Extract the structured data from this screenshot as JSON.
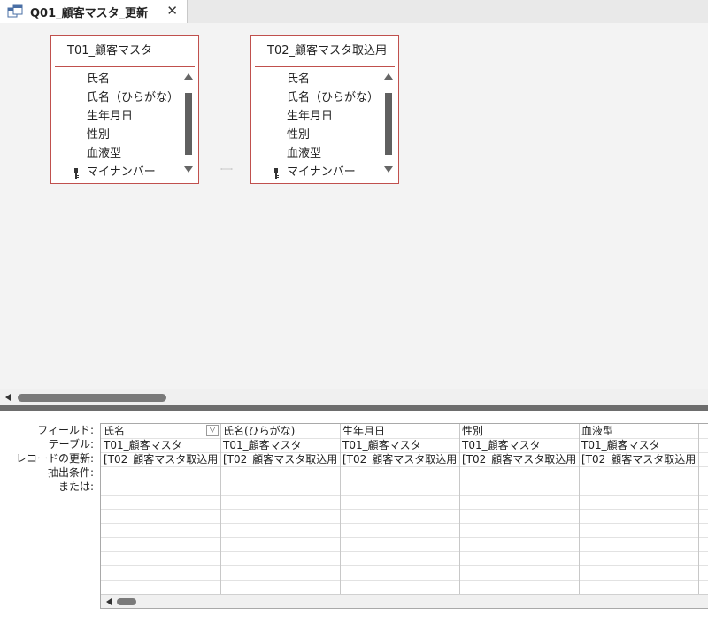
{
  "tab": {
    "title": "Q01_顧客マスタ_更新",
    "close_glyph": "✕",
    "icon": "query-icon"
  },
  "tables": [
    {
      "title": "T01_顧客マスタ",
      "fields": [
        {
          "name": "氏名",
          "key": false
        },
        {
          "name": "氏名（ひらがな）",
          "key": false
        },
        {
          "name": "生年月日",
          "key": false
        },
        {
          "name": "性別",
          "key": false
        },
        {
          "name": "血液型",
          "key": false
        },
        {
          "name": "マイナンバー",
          "key": true
        }
      ]
    },
    {
      "title": "T02_顧客マスタ取込用",
      "fields": [
        {
          "name": "氏名",
          "key": false
        },
        {
          "name": "氏名（ひらがな）",
          "key": false
        },
        {
          "name": "生年月日",
          "key": false
        },
        {
          "name": "性別",
          "key": false
        },
        {
          "name": "血液型",
          "key": false
        },
        {
          "name": "マイナンバー",
          "key": true
        }
      ]
    }
  ],
  "grid": {
    "row_labels": [
      "フィールド:",
      "テーブル:",
      "レコードの更新:",
      "抽出条件:",
      "または:"
    ],
    "columns": [
      {
        "field": "氏名",
        "table": "T01_顧客マスタ",
        "update": "[T02_顧客マスタ取込用",
        "dropdown": true
      },
      {
        "field": "氏名(ひらがな)",
        "table": "T01_顧客マスタ",
        "update": "[T02_顧客マスタ取込用",
        "dropdown": false
      },
      {
        "field": "生年月日",
        "table": "T01_顧客マスタ",
        "update": "[T02_顧客マスタ取込用",
        "dropdown": false
      },
      {
        "field": "性別",
        "table": "T01_顧客マスタ",
        "update": "[T02_顧客マスタ取込用",
        "dropdown": false
      },
      {
        "field": "血液型",
        "table": "T01_顧客マスタ",
        "update": "[T02_顧客マスタ取込用",
        "dropdown": false
      }
    ]
  },
  "colors": {
    "table_border": "#c0504d",
    "splitter": "#6d6d6d"
  }
}
